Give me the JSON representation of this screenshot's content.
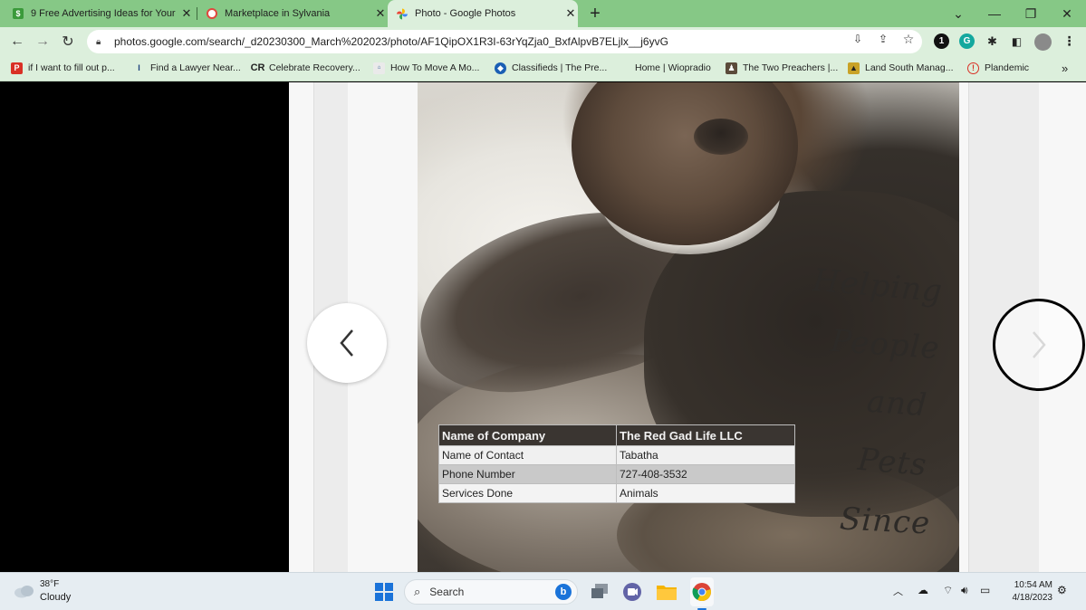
{
  "tabs": [
    {
      "title": "9 Free Advertising Ideas for Your",
      "favicon": "dollar-icon",
      "active": false
    },
    {
      "title": "Marketplace in Sylvania",
      "favicon": "marketplace-icon",
      "active": false
    },
    {
      "title": "Photo - Google Photos",
      "favicon": "google-photos-icon",
      "active": true
    }
  ],
  "new_tab_symbol": "+",
  "toolbar": {
    "url": "photos.google.com/search/_d20230300_March%202023/photo/AF1QipOX1R3I-63rYqZja0_BxfAlpvB7ELjlx__j6yvG"
  },
  "bookmarks": [
    {
      "label": "if I want to fill out p...",
      "icon": "pdf-icon"
    },
    {
      "label": "Find a Lawyer Near...",
      "icon": "lawyer-icon"
    },
    {
      "label": "Celebrate Recovery...",
      "icon": "cr-icon"
    },
    {
      "label": "How To Move A Mo...",
      "icon": "mobile-home-icon"
    },
    {
      "label": "Classifieds | The Pre...",
      "icon": "classifieds-icon"
    },
    {
      "label": "Home | Wiopradio",
      "icon": ""
    },
    {
      "label": "The Two Preachers |...",
      "icon": "preachers-icon"
    },
    {
      "label": "Land South Manag...",
      "icon": "land-icon"
    },
    {
      "label": "Plandemic",
      "icon": "plandemic-icon"
    }
  ],
  "bookmarks_overflow": "»",
  "photo": {
    "handwriting": [
      "Helping",
      "People",
      "and",
      "Pets",
      "Since"
    ],
    "table": {
      "header": [
        "Name of Company",
        "The Red Gad Life LLC"
      ],
      "rows": [
        [
          "Name of Contact",
          "Tabatha"
        ],
        [
          "Phone Number",
          "727-408-3532"
        ],
        [
          "Services Done",
          "Animals"
        ]
      ]
    }
  },
  "taskbar": {
    "weather_temp": "38°F",
    "weather_desc": "Cloudy",
    "search_label": "Search",
    "time": "10:54 AM",
    "date": "4/18/2023"
  }
}
